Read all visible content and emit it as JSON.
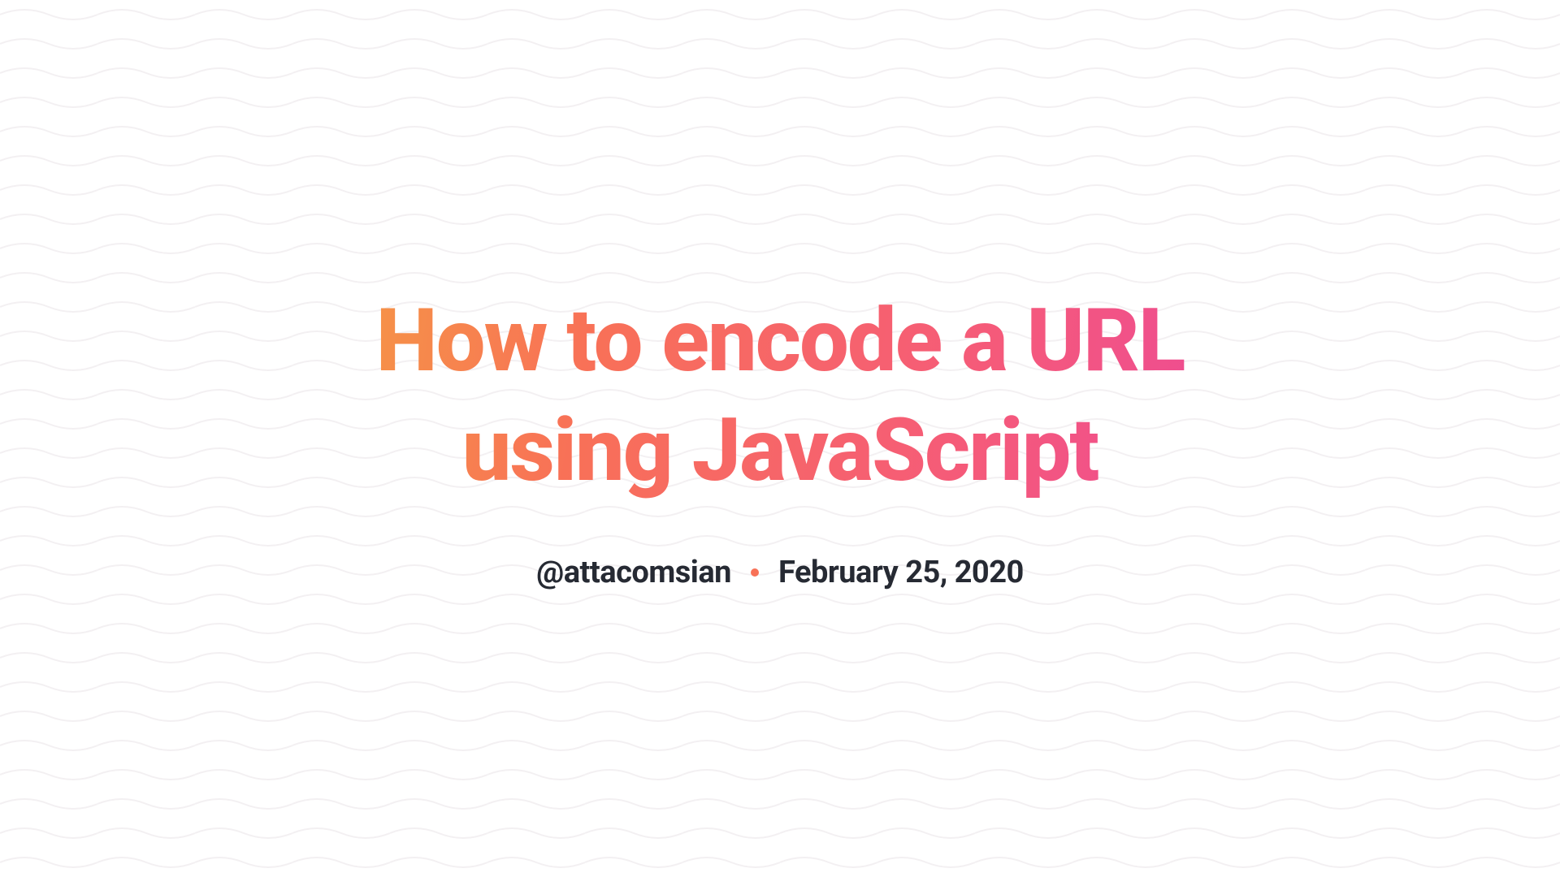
{
  "title": "How to encode a URL using JavaScript",
  "meta": {
    "author": "@attacomsian",
    "date": "February 25, 2020"
  },
  "colors": {
    "gradient_start": "#f59e42",
    "gradient_mid1": "#f87157",
    "gradient_mid2": "#f55a7a",
    "gradient_end": "#ec4899",
    "text": "#262a33",
    "dot": "#f87157",
    "wave": "#f3f0f2"
  }
}
